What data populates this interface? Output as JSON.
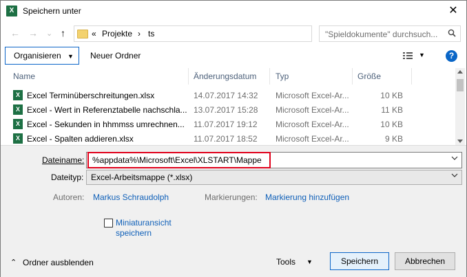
{
  "window": {
    "title": "Speichern unter",
    "close_glyph": "✕"
  },
  "nav": {
    "back_glyph": "←",
    "forward_glyph": "→",
    "recent_glyph": "⌄",
    "up_glyph": "↑",
    "breadcrumb_prefix": "«",
    "crumb1": "Projekte",
    "crumb_sep": "›",
    "crumb2": "ts",
    "search_placeholder": "\"Spieldokumente\" durchsuch..."
  },
  "toolbar": {
    "organize_label": "Organisieren",
    "organize_caret": "▼",
    "new_folder_label": "Neuer Ordner",
    "view_caret": "▼",
    "help_glyph": "?"
  },
  "columns": {
    "name": "Name",
    "modified": "Änderungsdatum",
    "type": "Typ",
    "size": "Größe"
  },
  "files": [
    {
      "name": "Excel Terminüberschreitungen.xlsx",
      "modified": "14.07.2017 14:32",
      "type": "Microsoft Excel-Ar...",
      "size": "10 KB"
    },
    {
      "name": "Excel - Wert in Referenztabelle nachschla...",
      "modified": "13.07.2017 15:28",
      "type": "Microsoft Excel-Ar...",
      "size": "11 KB"
    },
    {
      "name": "Excel - Sekunden in hhmmss umrechnen...",
      "modified": "11.07.2017 19:12",
      "type": "Microsoft Excel-Ar...",
      "size": "10 KB"
    },
    {
      "name": "Excel - Spalten addieren.xlsx",
      "modified": "11.07.2017 18:52",
      "type": "Microsoft Excel-Ar...",
      "size": "9 KB"
    }
  ],
  "file_icon_glyph": "X",
  "form": {
    "filename_label": "Dateiname:",
    "filename_value": "%appdata%\\Microsoft\\Excel\\XLSTART\\Mappe",
    "filetype_label": "Dateityp:",
    "filetype_value": "Excel-Arbeitsmappe (*.xlsx)",
    "authors_label": "Autoren:",
    "authors_value": "Markus Schraudolph",
    "tags_label": "Markierungen:",
    "tags_value": "Markierung hinzufügen",
    "thumb_line1": "Miniaturansicht",
    "thumb_line2": "speichern",
    "thumbnail_checked": false
  },
  "footer": {
    "hide_folders_glyph": "⌃",
    "hide_folders_label": "Ordner ausblenden",
    "tools_label": "Tools",
    "tools_caret": "▼",
    "save_label": "Speichern",
    "cancel_label": "Abbrechen"
  },
  "colors": {
    "accent": "#0a64c8",
    "link": "#0e5fb8",
    "highlight": "#e0001a",
    "excel_green": "#1d7044"
  }
}
